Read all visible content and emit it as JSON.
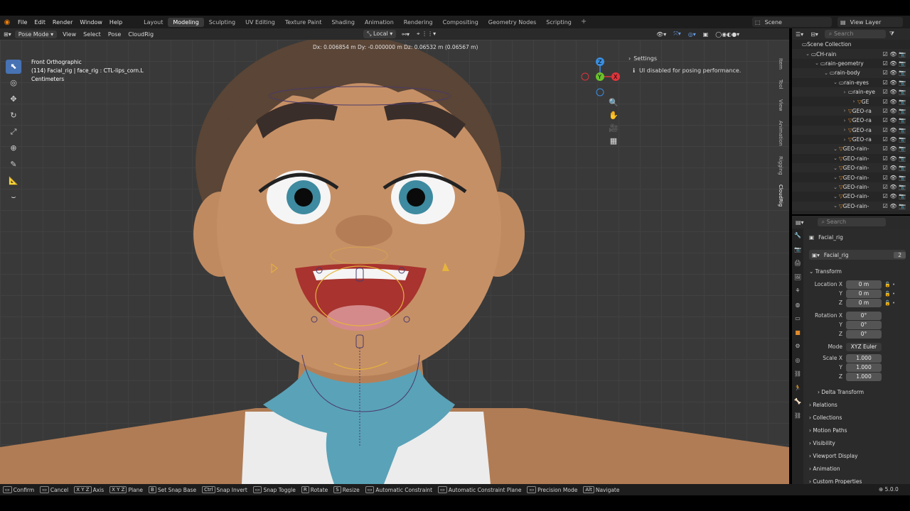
{
  "topbar": {
    "menus": [
      "File",
      "Edit",
      "Render",
      "Window",
      "Help"
    ],
    "workspaces": [
      "Layout",
      "Modeling",
      "Sculpting",
      "UV Editing",
      "Texture Paint",
      "Shading",
      "Animation",
      "Rendering",
      "Compositing",
      "Geometry Nodes",
      "Scripting"
    ],
    "active_workspace": "Modeling",
    "scene": "Scene",
    "view_layer": "View Layer"
  },
  "viewport_header": {
    "mode": "Pose Mode",
    "menus": [
      "View",
      "Select",
      "Pose",
      "CloudRig"
    ],
    "transform_orientation": "Local"
  },
  "viewport": {
    "view_name": "Front Orthographic",
    "object_info": "(114) Facial_rig | face_rig : CTL-lips_corn.L",
    "units": "Centimeters",
    "transform_readout": "Dx: 0.006854 m  Dy: -0.000000 m  Dz: 0.06532 m (0.06567 m)",
    "settings_title": "Settings",
    "settings_message": "UI disabled for posing performance.",
    "side_tabs": [
      "Item",
      "Tool",
      "View",
      "Animation",
      "Rigging",
      "CloudRig"
    ],
    "active_side_tab": "CloudRig",
    "gizmo_axes": [
      "Z",
      "Y",
      "X"
    ]
  },
  "outliner": {
    "search_placeholder": "Search",
    "rows": [
      {
        "label": "Scene Collection",
        "indent": 0
      },
      {
        "label": "CH-rain",
        "indent": 1
      },
      {
        "label": "rain-geometry",
        "indent": 2
      },
      {
        "label": "rain-body",
        "indent": 3
      },
      {
        "label": "rain-eyes",
        "indent": 4
      },
      {
        "label": "rain-eye",
        "indent": 5
      },
      {
        "label": "GE",
        "indent": 6
      },
      {
        "label": "GEO-ra",
        "indent": 5
      },
      {
        "label": "GEO-ra",
        "indent": 5
      },
      {
        "label": "GEO-ra",
        "indent": 5
      },
      {
        "label": "GEO-ra",
        "indent": 5
      },
      {
        "label": "GEO-rain-",
        "indent": 4
      },
      {
        "label": "GEO-rain-",
        "indent": 4
      },
      {
        "label": "GEO-rain-",
        "indent": 4
      },
      {
        "label": "GEO-rain-",
        "indent": 4
      },
      {
        "label": "GEO-rain-",
        "indent": 4
      },
      {
        "label": "GEO-rain-",
        "indent": 4
      },
      {
        "label": "GEO-rain-",
        "indent": 4
      }
    ]
  },
  "properties": {
    "search_placeholder": "Search",
    "object_name": "Facial_rig",
    "data_name": "Facial_rig",
    "user_count": "2",
    "transform_label": "Transform",
    "location_label": "Location X",
    "location": [
      "0 m",
      "0 m",
      "0 m"
    ],
    "rotation_label": "Rotation X",
    "rotation": [
      "0°",
      "0°",
      "0°"
    ],
    "mode_label": "Mode",
    "mode_value": "XYZ Euler",
    "scale_label": "Scale X",
    "scale": [
      "1.000",
      "1.000",
      "1.000"
    ],
    "axis_y": "Y",
    "axis_z": "Z",
    "sections": [
      "Delta Transform",
      "Relations",
      "Collections",
      "Motion Paths",
      "Visibility",
      "Viewport Display",
      "Animation",
      "Custom Properties"
    ]
  },
  "statusbar": {
    "items": [
      {
        "key": "",
        "label": "Confirm"
      },
      {
        "key": "",
        "label": "Cancel"
      },
      {
        "key": "X Y Z",
        "label": "Axis"
      },
      {
        "key": "X Y Z",
        "label": "Plane"
      },
      {
        "key": "B",
        "label": "Set Snap Base"
      },
      {
        "key": "Ctrl",
        "label": "Snap Invert"
      },
      {
        "key": "",
        "label": "Snap Toggle"
      },
      {
        "key": "R",
        "label": "Rotate"
      },
      {
        "key": "S",
        "label": "Resize"
      },
      {
        "key": "",
        "label": "Automatic Constraint"
      },
      {
        "key": "",
        "label": "Automatic Constraint Plane"
      },
      {
        "key": "",
        "label": "Precision Mode"
      },
      {
        "key": "Alt",
        "label": "Navigate"
      }
    ],
    "version": "5.0.0"
  },
  "colors": {
    "accent": "#4772b3",
    "bone_select": "#e6b43c",
    "bone_normal": "#4a3a6a",
    "axis_x": "#e0333b",
    "axis_y": "#6ac22a",
    "axis_z": "#3a8ee0"
  }
}
